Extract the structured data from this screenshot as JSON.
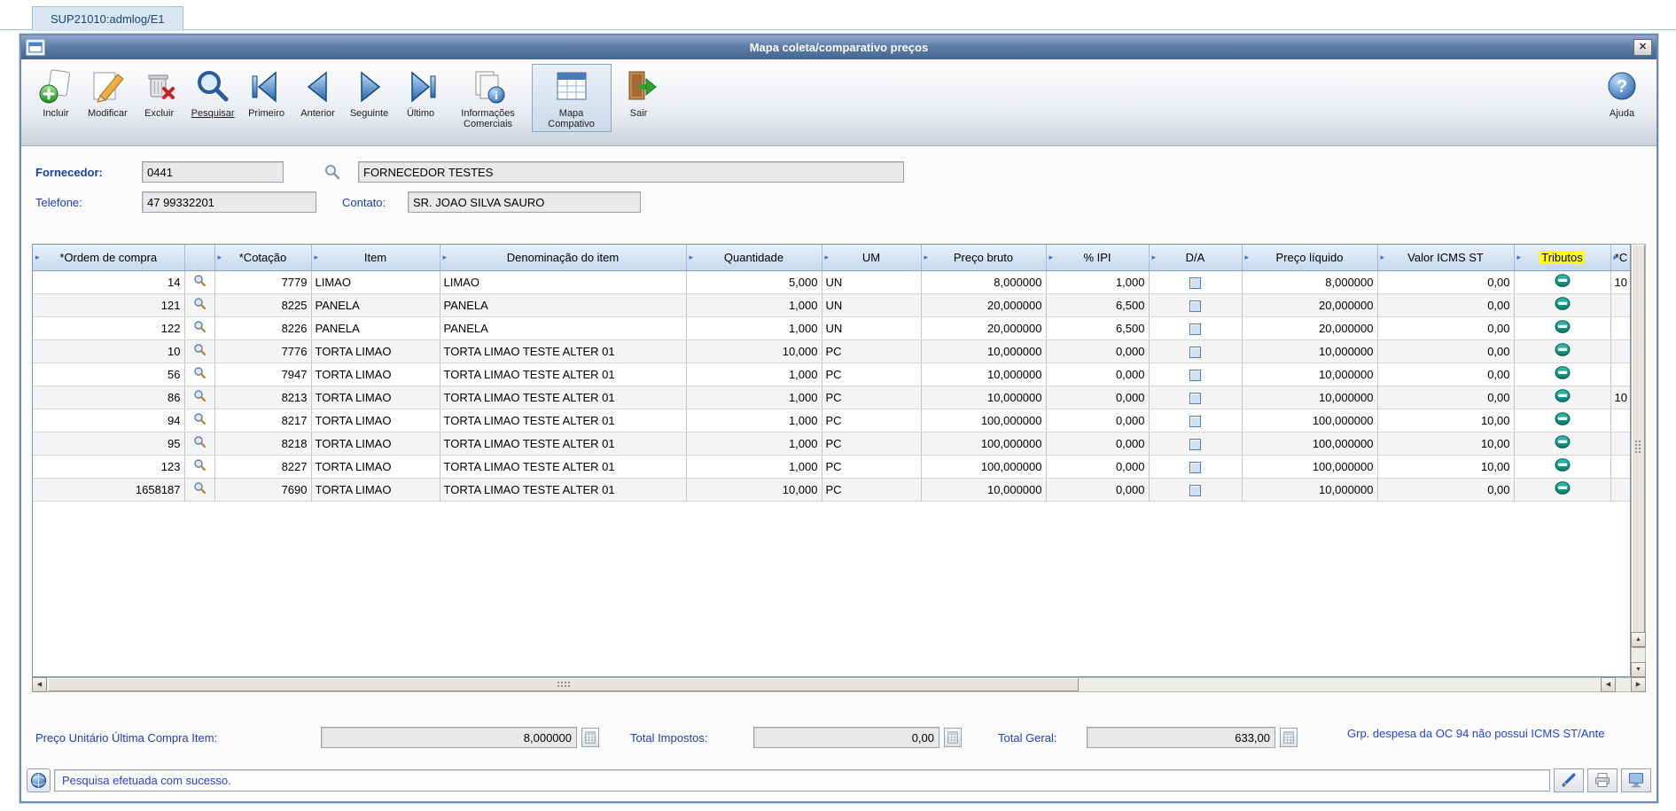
{
  "page": {
    "tab_title": "SUP21010:admlog/E1"
  },
  "window": {
    "title": "Mapa coleta/comparativo preços"
  },
  "icons": {
    "close": "✕",
    "sort_arrow": "▸",
    "up": "▲",
    "down": "▼",
    "left": "◀",
    "right": "▶",
    "help": "?"
  },
  "toolbar": {
    "buttons": [
      {
        "id": "incluir",
        "label": "Incluir"
      },
      {
        "id": "modificar",
        "label": "Modificar"
      },
      {
        "id": "excluir",
        "label": "Excluir"
      },
      {
        "id": "pesquisar",
        "label": "Pesquisar"
      },
      {
        "id": "primeiro",
        "label": "Primeiro"
      },
      {
        "id": "anterior",
        "label": "Anterior"
      },
      {
        "id": "seguinte",
        "label": "Seguinte"
      },
      {
        "id": "ultimo",
        "label": "Último"
      },
      {
        "id": "informacoes-comerciais",
        "label": "Informações Comerciais"
      },
      {
        "id": "mapa-compativo",
        "label": "Mapa Compativo"
      },
      {
        "id": "sair",
        "label": "Sair"
      }
    ],
    "help_label": "Ajuda"
  },
  "form": {
    "fornecedor_label": "Fornecedor:",
    "fornecedor_code": "0441",
    "fornecedor_name": "FORNECEDOR TESTES",
    "telefone_label": "Telefone:",
    "telefone_value": "47 99332201",
    "contato_label": "Contato:",
    "contato_value": "SR. JOAO SILVA SAURO"
  },
  "grid": {
    "headers": [
      "*Ordem de compra",
      "",
      "*Cotação",
      "Item",
      "Denominação do item",
      "Quantidade",
      "UM",
      "Preço bruto",
      "% IPI",
      "D/A",
      "Preço líquido",
      "Valor ICMS ST",
      "Tributos",
      "*C"
    ],
    "rows": [
      {
        "ordem": "14",
        "cotacao": "7779",
        "item": "LIMAO",
        "denominacao": "LIMAO",
        "qtd": "5,000",
        "um": "UN",
        "bruto": "8,000000",
        "ipi": "1,000",
        "liquido": "8,000000",
        "icms_st": "0,00",
        "extra": "10"
      },
      {
        "ordem": "121",
        "cotacao": "8225",
        "item": "PANELA",
        "denominacao": "PANELA",
        "qtd": "1,000",
        "um": "UN",
        "bruto": "20,000000",
        "ipi": "6,500",
        "liquido": "20,000000",
        "icms_st": "0,00",
        "extra": ""
      },
      {
        "ordem": "122",
        "cotacao": "8226",
        "item": "PANELA",
        "denominacao": "PANELA",
        "qtd": "1,000",
        "um": "UN",
        "bruto": "20,000000",
        "ipi": "6,500",
        "liquido": "20,000000",
        "icms_st": "0,00",
        "extra": ""
      },
      {
        "ordem": "10",
        "cotacao": "7776",
        "item": "TORTA LIMAO",
        "denominacao": "TORTA LIMAO TESTE ALTER 01",
        "qtd": "10,000",
        "um": "PC",
        "bruto": "10,000000",
        "ipi": "0,000",
        "liquido": "10,000000",
        "icms_st": "0,00",
        "extra": ""
      },
      {
        "ordem": "56",
        "cotacao": "7947",
        "item": "TORTA LIMAO",
        "denominacao": "TORTA LIMAO TESTE ALTER 01",
        "qtd": "1,000",
        "um": "PC",
        "bruto": "10,000000",
        "ipi": "0,000",
        "liquido": "10,000000",
        "icms_st": "0,00",
        "extra": ""
      },
      {
        "ordem": "86",
        "cotacao": "8213",
        "item": "TORTA LIMAO",
        "denominacao": "TORTA LIMAO TESTE ALTER 01",
        "qtd": "1,000",
        "um": "PC",
        "bruto": "10,000000",
        "ipi": "0,000",
        "liquido": "10,000000",
        "icms_st": "0,00",
        "extra": "10"
      },
      {
        "ordem": "94",
        "cotacao": "8217",
        "item": "TORTA LIMAO",
        "denominacao": "TORTA LIMAO TESTE ALTER 01",
        "qtd": "1,000",
        "um": "PC",
        "bruto": "100,000000",
        "ipi": "0,000",
        "liquido": "100,000000",
        "icms_st": "10,00",
        "extra": ""
      },
      {
        "ordem": "95",
        "cotacao": "8218",
        "item": "TORTA LIMAO",
        "denominacao": "TORTA LIMAO TESTE ALTER 01",
        "qtd": "1,000",
        "um": "PC",
        "bruto": "100,000000",
        "ipi": "0,000",
        "liquido": "100,000000",
        "icms_st": "10,00",
        "extra": ""
      },
      {
        "ordem": "123",
        "cotacao": "8227",
        "item": "TORTA LIMAO",
        "denominacao": "TORTA LIMAO TESTE ALTER 01",
        "qtd": "1,000",
        "um": "PC",
        "bruto": "100,000000",
        "ipi": "0,000",
        "liquido": "100,000000",
        "icms_st": "10,00",
        "extra": ""
      },
      {
        "ordem": "1658187",
        "cotacao": "7690",
        "item": "TORTA LIMAO",
        "denominacao": "TORTA LIMAO TESTE ALTER 01",
        "qtd": "10,000",
        "um": "PC",
        "bruto": "10,000000",
        "ipi": "0,000",
        "liquido": "10,000000",
        "icms_st": "0,00",
        "extra": ""
      }
    ]
  },
  "footer": {
    "preco_unitario_label": "Preço Unitário Última Compra Item:",
    "preco_unitario_value": "8,000000",
    "total_impostos_label": "Total Impostos:",
    "total_impostos_value": "0,00",
    "total_geral_label": "Total Geral:",
    "total_geral_value": "633,00",
    "message": "Grp. despesa da OC 94 não possui ICMS ST/Ante"
  },
  "statusbar": {
    "message": "Pesquisa efetuada com sucesso."
  }
}
